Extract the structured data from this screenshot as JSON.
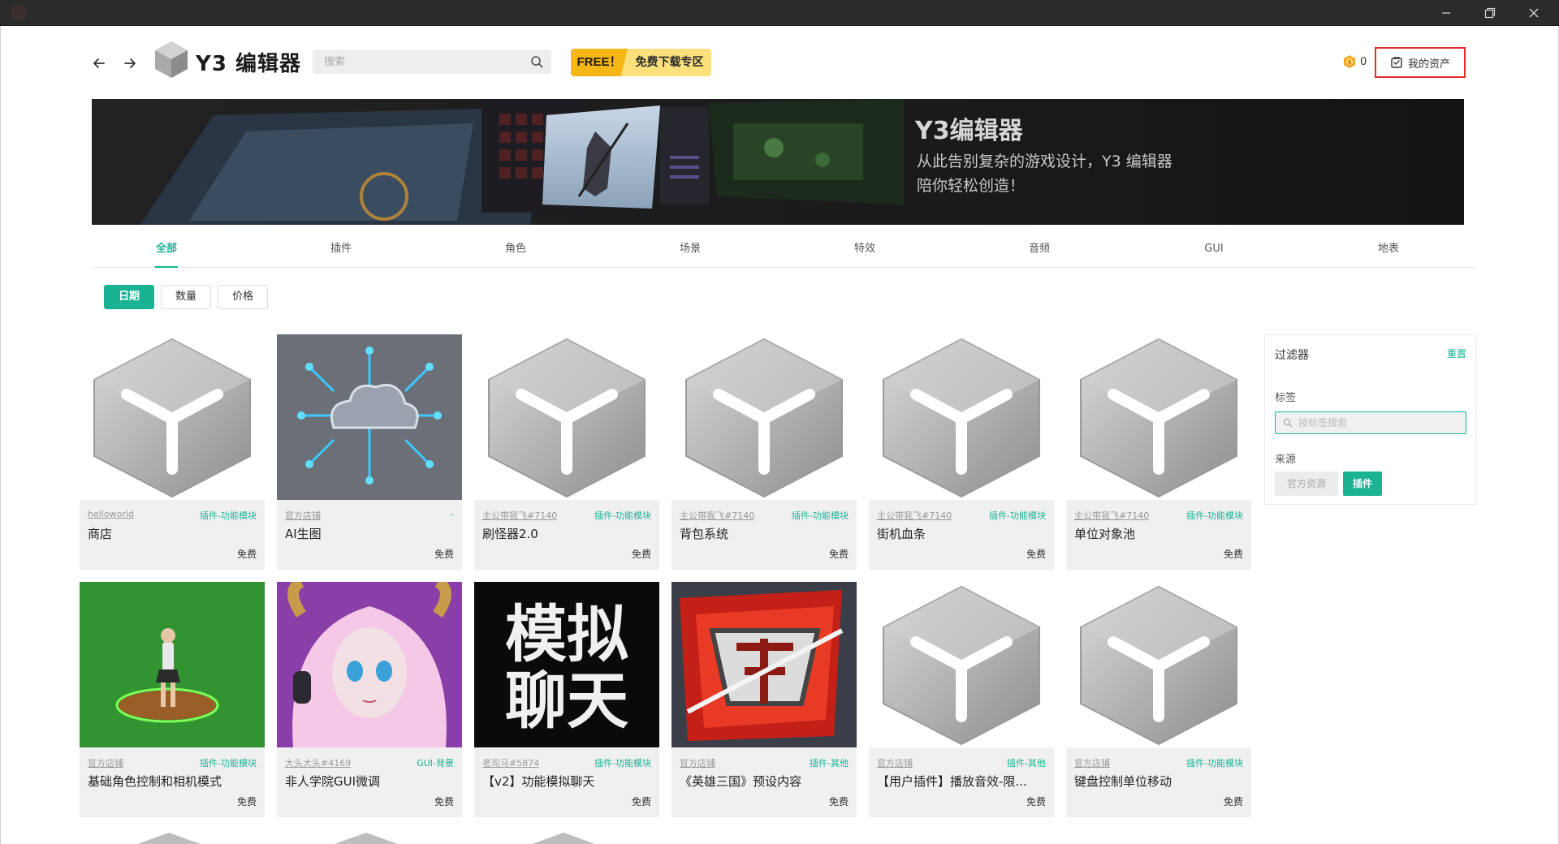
{
  "window": {
    "minimize": "minimize",
    "restore": "restore",
    "close": "close"
  },
  "header": {
    "logo_text": "Y3 编辑器",
    "search_placeholder": "搜索",
    "free_tag": "FREE！",
    "free_text": "免费下载专区",
    "coin_count": "0",
    "my_assets": "我的资产"
  },
  "hero": {
    "title": "Y3编辑器",
    "subtitle_line1": "从此告别复杂的游戏设计，Y3 编辑器",
    "subtitle_line2": "陪你轻松创造！"
  },
  "tabs": [
    "全部",
    "插件",
    "角色",
    "场景",
    "特效",
    "音频",
    "GUI",
    "地表"
  ],
  "active_tab": 0,
  "sort": [
    "日期",
    "数量",
    "价格"
  ],
  "active_sort": 0,
  "cards": [
    {
      "author": "helloworld",
      "category": "插件-功能模块",
      "title": "商店",
      "price": "免费",
      "thumb": "cube"
    },
    {
      "author": "官方店铺",
      "category": "-",
      "title": "AI生图",
      "price": "免费",
      "thumb": "ai"
    },
    {
      "author": "主公带我飞#7140",
      "category": "插件-功能模块",
      "title": "刷怪器2.0",
      "price": "免费",
      "thumb": "cube"
    },
    {
      "author": "主公带我飞#7140",
      "category": "插件-功能模块",
      "title": "背包系统",
      "price": "免费",
      "thumb": "cube"
    },
    {
      "author": "主公带我飞#7140",
      "category": "插件-功能模块",
      "title": "街机血条",
      "price": "免费",
      "thumb": "cube"
    },
    {
      "author": "主公带我飞#7140",
      "category": "插件-功能模块",
      "title": "单位对象池",
      "price": "免费",
      "thumb": "cube"
    },
    {
      "author": "官方店铺",
      "category": "插件-功能模块",
      "title": "基础角色控制和相机模式",
      "price": "免费",
      "thumb": "green"
    },
    {
      "author": "大头大头#4169",
      "category": "GUI-背景",
      "title": "非人学院GUI微调",
      "price": "免费",
      "thumb": "anime"
    },
    {
      "author": "老司马#5874",
      "category": "插件-功能模块",
      "title": "【v2】功能模拟聊天",
      "price": "免费",
      "thumb": "chat",
      "thumb_text_1": "模拟",
      "thumb_text_2": "聊天"
    },
    {
      "author": "官方店铺",
      "category": "插件-其他",
      "title": "《英雄三国》预设内容",
      "price": "免费",
      "thumb": "hero"
    },
    {
      "author": "官方店铺",
      "category": "插件-其他",
      "title": "【用户插件】播放音效-限...",
      "price": "免费",
      "thumb": "cube"
    },
    {
      "author": "官方店铺",
      "category": "插件-功能模块",
      "title": "键盘控制单位移动",
      "price": "免费",
      "thumb": "cube"
    }
  ],
  "filter": {
    "title": "过滤器",
    "reset": "重置",
    "tag_label": "标签",
    "tag_placeholder": "按标签搜索",
    "source_label": "来源",
    "source_official": "官方资源",
    "source_plugin": "插件"
  },
  "colors": {
    "accent": "#19b394",
    "free_yellow": "#f5b715",
    "highlight_red": "#e02e2e"
  }
}
